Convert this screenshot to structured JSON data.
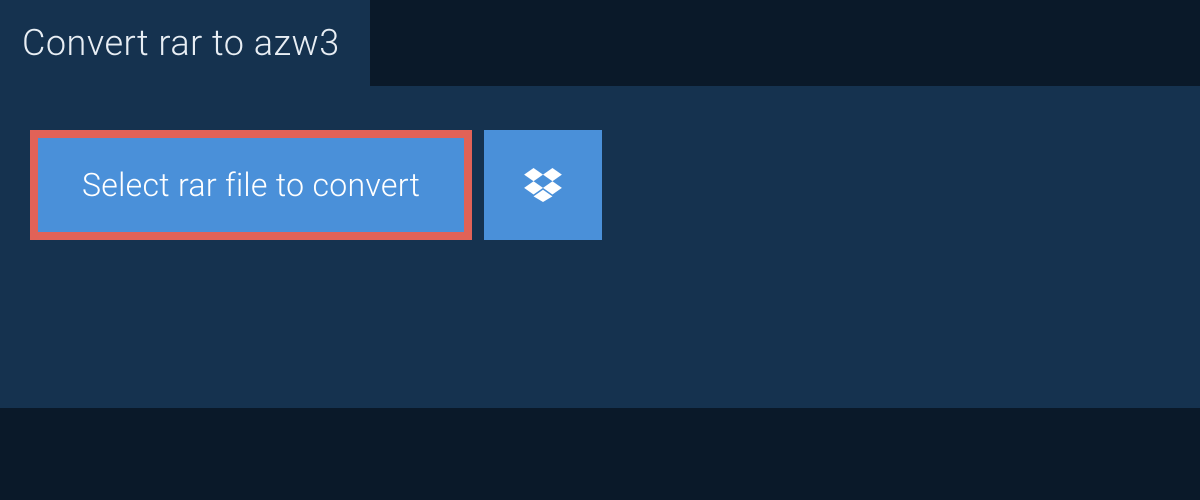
{
  "tab": {
    "title": "Convert rar to azw3"
  },
  "actions": {
    "select_file_label": "Select rar file to convert"
  },
  "colors": {
    "background": "#0a1929",
    "panel": "#15324f",
    "button": "#4a90d9",
    "highlight_border": "#e16257",
    "text_light": "#e8eef4",
    "text_white": "#ffffff"
  }
}
